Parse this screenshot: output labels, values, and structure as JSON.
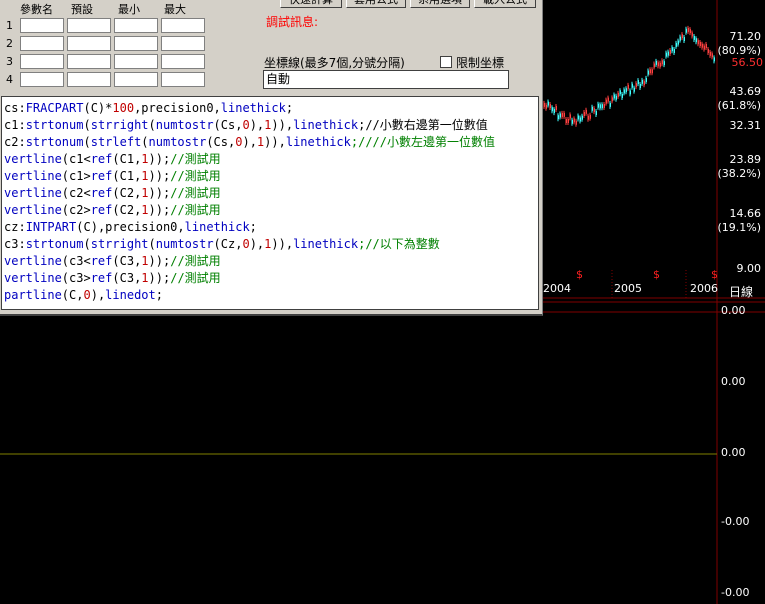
{
  "param_table": {
    "headers": [
      "參數名",
      "預設",
      "最小",
      "最大"
    ],
    "rows": [
      "1",
      "2",
      "3",
      "4"
    ]
  },
  "top_buttons": [
    "快速計算",
    "套用公式",
    "系用選項",
    "載入公式"
  ],
  "debug_label": "調試訊息:",
  "axis_setting": {
    "label": "坐標線(最多7個,分號分隔)",
    "value": "自動",
    "limit_label": "限制坐標"
  },
  "code_lines": [
    [
      [
        "tx",
        "cs:"
      ],
      [
        "kw",
        "FRACPART"
      ],
      [
        "tx",
        "(C)*"
      ],
      [
        "nm",
        "100"
      ],
      [
        "tx",
        ",precision0,"
      ],
      [
        "kw",
        "linethick"
      ],
      [
        "tx",
        ";"
      ]
    ],
    [
      [
        "tx",
        "c1:"
      ],
      [
        "kw",
        "strtonum"
      ],
      [
        "tx",
        "("
      ],
      [
        "kw",
        "strright"
      ],
      [
        "tx",
        "("
      ],
      [
        "kw",
        "numtostr"
      ],
      [
        "tx",
        "(Cs,"
      ],
      [
        "nm",
        "0"
      ],
      [
        "tx",
        "),"
      ],
      [
        "nm",
        "1"
      ],
      [
        "tx",
        "))"
      ],
      [
        "tx",
        ","
      ],
      [
        "kw",
        "linethick"
      ],
      [
        "tx",
        ";//小數右邊第一位數值"
      ]
    ],
    [
      [
        "tx",
        "c2:"
      ],
      [
        "kw",
        "strtonum"
      ],
      [
        "tx",
        "("
      ],
      [
        "kw",
        "strleft"
      ],
      [
        "tx",
        "("
      ],
      [
        "kw",
        "numtostr"
      ],
      [
        "tx",
        "(Cs,"
      ],
      [
        "nm",
        "0"
      ],
      [
        "tx",
        "),"
      ],
      [
        "nm",
        "1"
      ],
      [
        "tx",
        "))"
      ],
      [
        "tx",
        ","
      ],
      [
        "kw",
        "linethick"
      ],
      [
        "cm",
        ";////小數左邊第一位數值"
      ]
    ],
    [
      [
        "kw",
        "vertline"
      ],
      [
        "tx",
        "(c1<"
      ],
      [
        "kw",
        "ref"
      ],
      [
        "tx",
        "(C1,"
      ],
      [
        "nm",
        "1"
      ],
      [
        "tx",
        "));"
      ],
      [
        "cm",
        "//測試用"
      ]
    ],
    [
      [
        "kw",
        "vertline"
      ],
      [
        "tx",
        "(c1>"
      ],
      [
        "kw",
        "ref"
      ],
      [
        "tx",
        "(C1,"
      ],
      [
        "nm",
        "1"
      ],
      [
        "tx",
        "));"
      ],
      [
        "cm",
        "//測試用"
      ]
    ],
    [
      [
        "kw",
        "vertline"
      ],
      [
        "tx",
        "(c2<"
      ],
      [
        "kw",
        "ref"
      ],
      [
        "tx",
        "(C2,"
      ],
      [
        "nm",
        "1"
      ],
      [
        "tx",
        "));"
      ],
      [
        "cm",
        "//測試用"
      ]
    ],
    [
      [
        "kw",
        "vertline"
      ],
      [
        "tx",
        "(c2>"
      ],
      [
        "kw",
        "ref"
      ],
      [
        "tx",
        "(C2,"
      ],
      [
        "nm",
        "1"
      ],
      [
        "tx",
        "));"
      ],
      [
        "cm",
        "//測試用"
      ]
    ],
    [
      [
        "tx",
        "cz:"
      ],
      [
        "kw",
        "INTPART"
      ],
      [
        "tx",
        "(C),precision0,"
      ],
      [
        "kw",
        "linethick"
      ],
      [
        "tx",
        ";"
      ]
    ],
    [
      [
        "tx",
        "c3:"
      ],
      [
        "kw",
        "strtonum"
      ],
      [
        "tx",
        "("
      ],
      [
        "kw",
        "strright"
      ],
      [
        "tx",
        "("
      ],
      [
        "kw",
        "numtostr"
      ],
      [
        "tx",
        "(Cz,"
      ],
      [
        "nm",
        "0"
      ],
      [
        "tx",
        "),"
      ],
      [
        "nm",
        "1"
      ],
      [
        "tx",
        "))"
      ],
      [
        "tx",
        ","
      ],
      [
        "kw",
        "linethick"
      ],
      [
        "cm",
        ";//以下為整數"
      ]
    ],
    [
      [
        "kw",
        "vertline"
      ],
      [
        "tx",
        "(c3<"
      ],
      [
        "kw",
        "ref"
      ],
      [
        "tx",
        "(C3,"
      ],
      [
        "nm",
        "1"
      ],
      [
        "tx",
        "));"
      ],
      [
        "cm",
        "//測試用"
      ]
    ],
    [
      [
        "kw",
        "vertline"
      ],
      [
        "tx",
        "(c3>"
      ],
      [
        "kw",
        "ref"
      ],
      [
        "tx",
        "(C3,"
      ],
      [
        "nm",
        "1"
      ],
      [
        "tx",
        "));"
      ],
      [
        "cm",
        "//測試用"
      ]
    ],
    [
      [
        "kw",
        "partline"
      ],
      [
        "tx",
        "(C,"
      ],
      [
        "nm",
        "0"
      ],
      [
        "tx",
        "),"
      ],
      [
        "kw",
        "linedot"
      ],
      [
        "tx",
        ";"
      ]
    ]
  ],
  "price_axis": {
    "labels": [
      "71.20",
      "43.69",
      "32.31",
      "23.89",
      "14.66",
      "9.00"
    ],
    "percent_labels": [
      "(80.9%)",
      "(61.8%)",
      "(38.2%)",
      "(19.1%)"
    ],
    "current_price": "56.50"
  },
  "date_axis": [
    "2004",
    "2005",
    "2006"
  ],
  "dividend_marks": [
    "$",
    "$",
    "$"
  ],
  "period": "日線",
  "lower_axis": [
    "0.00",
    "0.00",
    "0.00",
    "-0.00",
    "-0.00",
    "-0.00"
  ],
  "colors": {
    "grid": "#800000",
    "zero_line": "#808000",
    "candle_up": "#ff4040",
    "candle_down": "#40ffff"
  }
}
